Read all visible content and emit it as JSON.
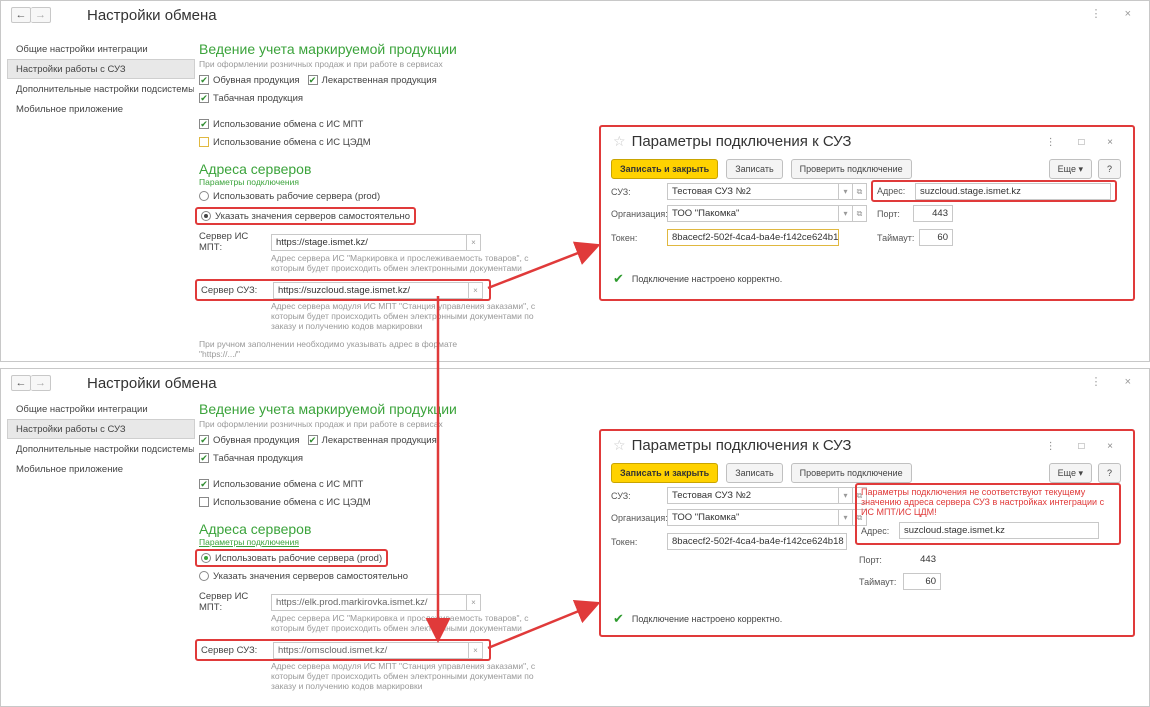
{
  "window": {
    "nav_back": "←",
    "nav_forward": "→",
    "title": "Настройки обмена",
    "controls": "⋮ ×"
  },
  "sidebar": {
    "items": [
      "Общие настройки интеграции",
      "Настройки работы с СУЗ",
      "Дополнительные настройки подсистемы",
      "Мобильное приложение"
    ]
  },
  "accounting": {
    "heading": "Ведение учета маркируемой продукции",
    "hint": "При оформлении розничных продаж и при работе в сервисах",
    "shoes": "Обувная продукция",
    "drugs": "Лекарственная продукция",
    "tobacco": "Табачная продукция",
    "mpt_exchange": "Использование обмена с ИС МПТ",
    "cdm_exchange": "Использование обмена с ИС ЦЭДМ"
  },
  "servers": {
    "heading": "Адреса серверов",
    "params_label": "Параметры подключения",
    "prod_option": "Использовать рабочие сервера (prod)",
    "manual_option": "Указать значения серверов самостоятельно",
    "mpt_label": "Сервер ИС МПТ:",
    "suz_label": "Сервер СУЗ:",
    "mpt_desc": "Адрес сервера ИС \"Маркировка и прослеживаемость товаров\", с которым будет происходить обмен электронными документами",
    "suz_desc": "Адрес сервера модуля ИС МПТ \"Станция управления заказами\", с которым будет происходить обмен электронными документами по заказу и получению кодов маркировки",
    "manual_note": "При ручном заполнении необходимо указывать адрес в формате \"https://.../\""
  },
  "top_panel": {
    "mpt_value": "https://stage.ismet.kz/",
    "suz_value": "https://suzcloud.stage.ismet.kz/"
  },
  "bottom_panel": {
    "mpt_value": "https://elk.prod.markirovka.ismet.kz/",
    "suz_value": "https://omscloud.ismet.kz/"
  },
  "dialog": {
    "title": "Параметры подключения к СУЗ",
    "controls": "⋮ □ ×",
    "save_close": "Записать и закрыть",
    "save": "Записать",
    "check": "Проверить подключение",
    "more": "Еще",
    "help": "?",
    "suz_label": "СУЗ:",
    "suz_value": "Тестовая СУЗ №2",
    "org_label": "Организация:",
    "org_value": "ТОО \"Пакомка\"",
    "token_label": "Токен:",
    "token_value": "8bacecf2-502f-4ca4-ba4e-f142ce624b18",
    "address_label": "Адрес:",
    "address_value": "suzcloud.stage.ismet.kz",
    "port_label": "Порт:",
    "port_value": "443",
    "timeout_label": "Таймаут:",
    "timeout_value": "60",
    "ok_msg": "Подключение настроено корректно.",
    "error_msg": "Параметры подключения не соответствуют текущему значению адреса сервера СУЗ в настройках интеграции с ИС МПТ/ИС ЦДМ!"
  },
  "colors": {
    "accent_green": "#3ba33b",
    "highlight_red": "#e03a3a",
    "primary_yellow": "#ffd200"
  }
}
